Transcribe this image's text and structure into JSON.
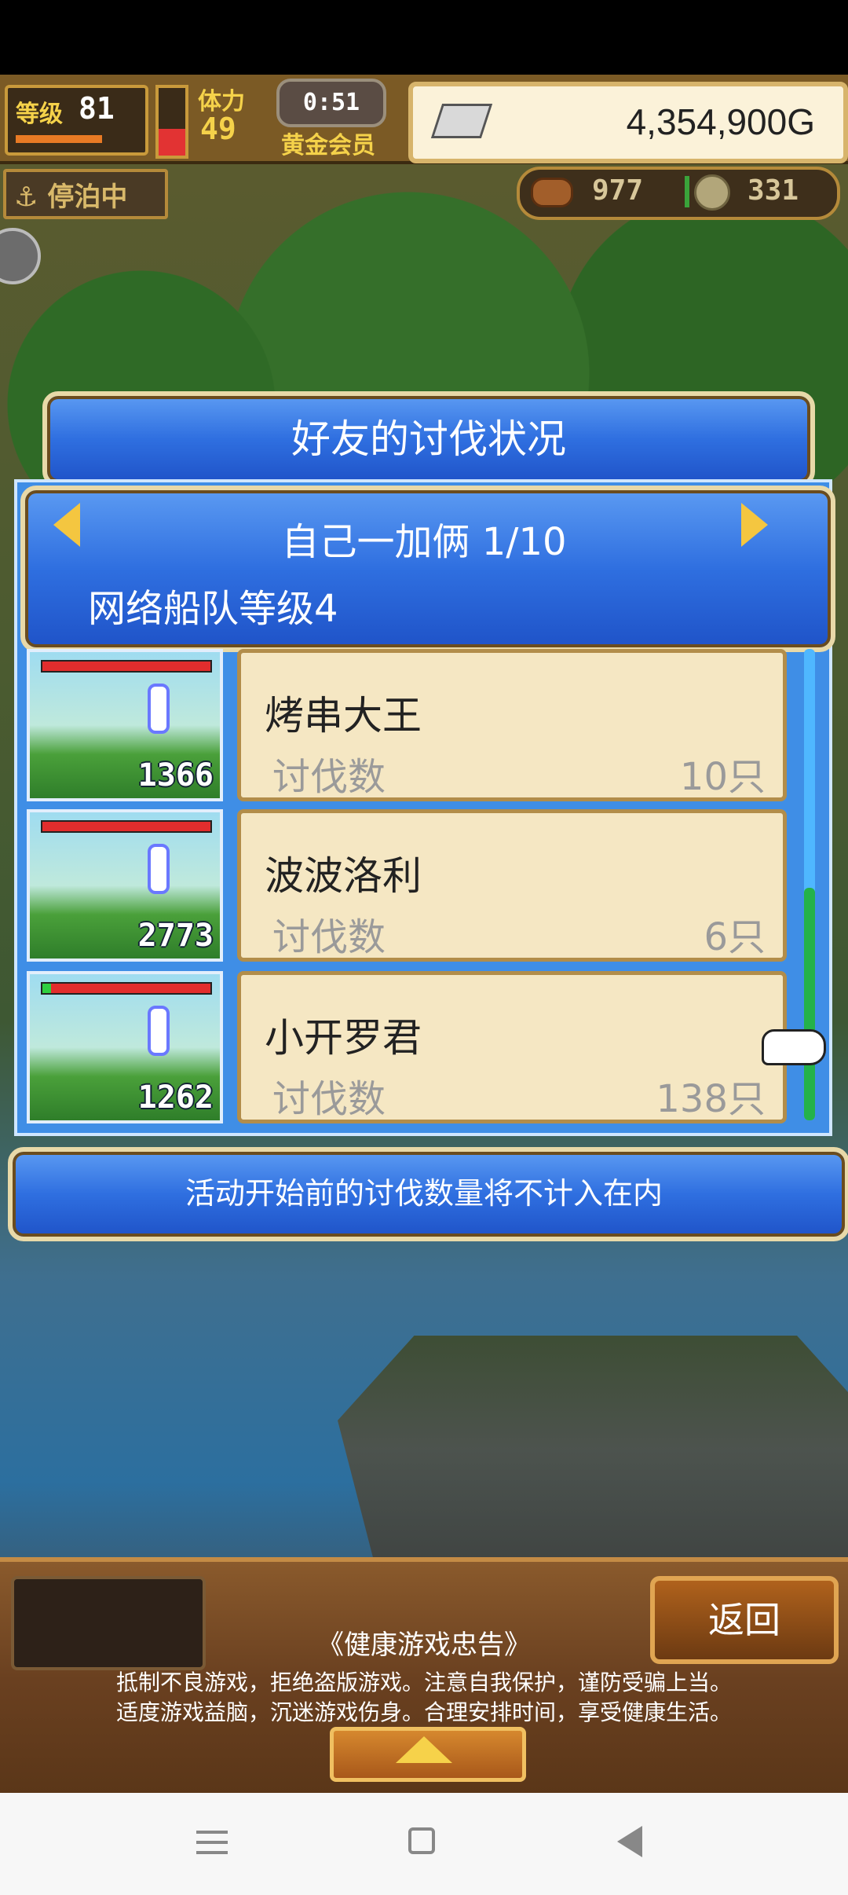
{
  "hud": {
    "level_label": "等级",
    "level": "81",
    "stamina_label": "体力",
    "stamina": "49",
    "timer": "0:51",
    "membership": "黄金会员",
    "money": "4,354,900G",
    "ship_status": "停泊中",
    "wood": "977",
    "ore": "331",
    "hp_level": 0.4
  },
  "dialog": {
    "title": "好友的讨伐状况",
    "friend_name": "自己一加俩 1/10",
    "fleet_level": "网络船队等级4",
    "notice": "活动开始前的讨伐数量将不计入在内",
    "rows": [
      {
        "name": "烤串大王",
        "label": "讨伐数",
        "count": "10只",
        "thumb_count": "1366",
        "hp": 1.0
      },
      {
        "name": "波波洛利",
        "label": "讨伐数",
        "count": "6只",
        "thumb_count": "2773",
        "hp": 1.0
      },
      {
        "name": "小开罗君",
        "label": "讨伐数",
        "count": "138只",
        "thumb_count": "1262",
        "hp": 0.05
      }
    ]
  },
  "bottom": {
    "back_label": "返回",
    "health_title": "《健康游戏忠告》",
    "health_line1": "抵制不良游戏，拒绝盗版游戏。注意自我保护，谨防受骗上当。",
    "health_line2": "适度游戏益脑，沉迷游戏伤身。合理安排时间，享受健康生活。"
  }
}
